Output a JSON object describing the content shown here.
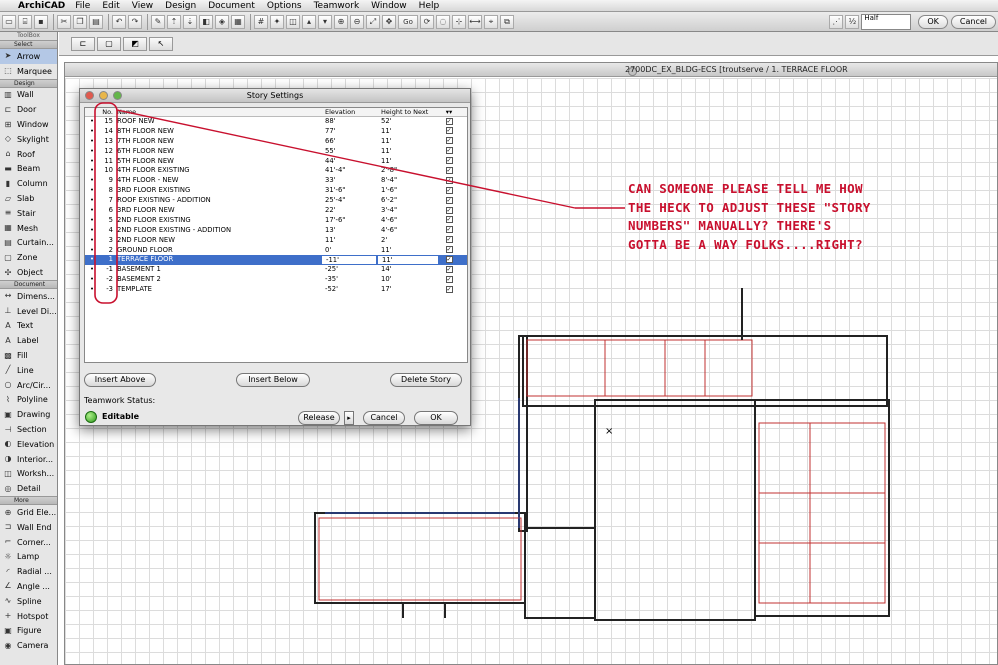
{
  "menubar": {
    "app": "ArchiCAD",
    "items": [
      "File",
      "Edit",
      "View",
      "Design",
      "Document",
      "Options",
      "Teamwork",
      "Window",
      "Help"
    ]
  },
  "toolbar": {
    "go_label": "Go",
    "half_label": "Half",
    "ok_label": "OK",
    "cancel_label": "Cancel"
  },
  "toolbox": {
    "title": "ToolBox",
    "select_header": "Select",
    "select_tools": [
      {
        "label": "Arrow",
        "icon": "arrow-icon",
        "glyph": "➤"
      },
      {
        "label": "Marquee",
        "icon": "marquee-icon",
        "glyph": "⬚"
      }
    ],
    "design_header": "Design",
    "design_tools": [
      {
        "label": "Wall",
        "icon": "wall-icon",
        "glyph": "▥"
      },
      {
        "label": "Door",
        "icon": "door-icon",
        "glyph": "⊏"
      },
      {
        "label": "Window",
        "icon": "window-icon",
        "glyph": "⊞"
      },
      {
        "label": "Skylight",
        "icon": "skylight-icon",
        "glyph": "◇"
      },
      {
        "label": "Roof",
        "icon": "roof-icon",
        "glyph": "⌂"
      },
      {
        "label": "Beam",
        "icon": "beam-icon",
        "glyph": "▬"
      },
      {
        "label": "Column",
        "icon": "column-icon",
        "glyph": "▮"
      },
      {
        "label": "Slab",
        "icon": "slab-icon",
        "glyph": "▱"
      },
      {
        "label": "Stair",
        "icon": "stair-icon",
        "glyph": "≡"
      },
      {
        "label": "Mesh",
        "icon": "mesh-icon",
        "glyph": "▦"
      },
      {
        "label": "Curtain...",
        "icon": "curtain-wall-icon",
        "glyph": "▤"
      },
      {
        "label": "Zone",
        "icon": "zone-icon",
        "glyph": "▢"
      },
      {
        "label": "Object",
        "icon": "object-icon",
        "glyph": "✣"
      }
    ],
    "document_header": "Document",
    "document_tools": [
      {
        "label": "Dimens...",
        "icon": "dimension-icon",
        "glyph": "↔"
      },
      {
        "label": "Level Di...",
        "icon": "level-dimension-icon",
        "glyph": "⊥"
      },
      {
        "label": "Text",
        "icon": "text-icon",
        "glyph": "A"
      },
      {
        "label": "Label",
        "icon": "label-icon",
        "glyph": "A"
      },
      {
        "label": "Fill",
        "icon": "fill-icon",
        "glyph": "▩"
      },
      {
        "label": "Line",
        "icon": "line-icon",
        "glyph": "╱"
      },
      {
        "label": "Arc/Cir...",
        "icon": "arc-circle-icon",
        "glyph": "○"
      },
      {
        "label": "Polyline",
        "icon": "polyline-icon",
        "glyph": "⌇"
      },
      {
        "label": "Drawing",
        "icon": "drawing-icon",
        "glyph": "▣"
      },
      {
        "label": "Section",
        "icon": "section-icon",
        "glyph": "⊣"
      },
      {
        "label": "Elevation",
        "icon": "elevation-icon",
        "glyph": "◐"
      },
      {
        "label": "Interior...",
        "icon": "interior-elevation-icon",
        "glyph": "◑"
      },
      {
        "label": "Worksh...",
        "icon": "worksheet-icon",
        "glyph": "◫"
      },
      {
        "label": "Detail",
        "icon": "detail-icon",
        "glyph": "◎"
      }
    ],
    "more_header": "More",
    "more_tools": [
      {
        "label": "Grid Ele...",
        "icon": "grid-element-icon",
        "glyph": "⊕"
      },
      {
        "label": "Wall End",
        "icon": "wall-end-icon",
        "glyph": "⊐"
      },
      {
        "label": "Corner...",
        "icon": "corner-window-icon",
        "glyph": "⌐"
      },
      {
        "label": "Lamp",
        "icon": "lamp-icon",
        "glyph": "☼"
      },
      {
        "label": "Radial ...",
        "icon": "radial-dimension-icon",
        "glyph": "◜"
      },
      {
        "label": "Angle ...",
        "icon": "angle-dimension-icon",
        "glyph": "∠"
      },
      {
        "label": "Spline",
        "icon": "spline-icon",
        "glyph": "∿"
      },
      {
        "label": "Hotspot",
        "icon": "hotspot-icon",
        "glyph": "+"
      },
      {
        "label": "Figure",
        "icon": "figure-icon",
        "glyph": "▣"
      },
      {
        "label": "Camera",
        "icon": "camera-icon",
        "glyph": "◉"
      }
    ]
  },
  "drawing_window": {
    "title": "2700DC_EX_BLDG-ECS  [troutserve / 1. TERRACE FLOOR"
  },
  "dialog": {
    "title": "Story Settings",
    "headers": {
      "no": "No.",
      "name": "Name",
      "elevation": "Elevation",
      "height": "Height to Next"
    },
    "stories": [
      {
        "no": "15",
        "name": "ROOF NEW",
        "elev": "88'",
        "ht": "52'"
      },
      {
        "no": "14",
        "name": "8TH FLOOR NEW",
        "elev": "77'",
        "ht": "11'"
      },
      {
        "no": "13",
        "name": "7TH FLOOR NEW",
        "elev": "66'",
        "ht": "11'"
      },
      {
        "no": "12",
        "name": "6TH FLOOR NEW",
        "elev": "55'",
        "ht": "11'"
      },
      {
        "no": "11",
        "name": "5TH FLOOR NEW",
        "elev": "44'",
        "ht": "11'"
      },
      {
        "no": "10",
        "name": "4TH FLOOR EXISTING",
        "elev": "41'-4\"",
        "ht": "2'-8\""
      },
      {
        "no": "9",
        "name": "4TH FLOOR - NEW",
        "elev": "33'",
        "ht": "8'-4\""
      },
      {
        "no": "8",
        "name": "3RD FLOOR EXISTING",
        "elev": "31'-6\"",
        "ht": "1'-6\""
      },
      {
        "no": "7",
        "name": "ROOF EXISTING - ADDITION",
        "elev": "25'-4\"",
        "ht": "6'-2\""
      },
      {
        "no": "6",
        "name": "3RD FLOOR NEW",
        "elev": "22'",
        "ht": "3'-4\""
      },
      {
        "no": "5",
        "name": "2ND FLOOR EXISTING",
        "elev": "17'-6\"",
        "ht": "4'-6\""
      },
      {
        "no": "4",
        "name": "2ND FLOOR EXISTING - ADDITION",
        "elev": "13'",
        "ht": "4'-6\""
      },
      {
        "no": "3",
        "name": "2ND FLOOR NEW",
        "elev": "11'",
        "ht": "2'"
      },
      {
        "no": "2",
        "name": "GROUND FLOOR",
        "elev": "0'",
        "ht": "11'"
      },
      {
        "no": "1",
        "name": "TERRACE FLOOR",
        "elev": "-11'",
        "ht": "11'",
        "selected": true
      },
      {
        "no": "-1",
        "name": "BASEMENT 1",
        "elev": "-25'",
        "ht": "14'"
      },
      {
        "no": "-2",
        "name": "BASEMENT 2",
        "elev": "-35'",
        "ht": "10'"
      },
      {
        "no": "-3",
        "name": "TEMPLATE",
        "elev": "-52'",
        "ht": "17'"
      }
    ],
    "insert_above_label": "Insert Above",
    "insert_below_label": "Insert Below",
    "delete_story_label": "Delete Story",
    "teamwork_label": "Teamwork Status:",
    "teamwork_status": "Editable",
    "release_label": "Release",
    "cancel_label": "Cancel",
    "ok_label": "OK"
  },
  "annotation": {
    "lines": [
      "Can someone please tell me how",
      "the heck to adjust these \"story",
      "numbers\" manually? There's",
      "gotta be a way folks....right?"
    ],
    "color": "#c8102e"
  }
}
